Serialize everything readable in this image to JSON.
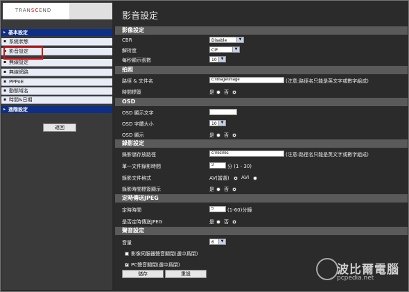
{
  "logo": {
    "prefix": "TRAN",
    "accent": "SC",
    "suffix": "END"
  },
  "sidebar": {
    "items": [
      {
        "label": "基本設定",
        "kind": "head"
      },
      {
        "label": "系統狀態",
        "kind": "sub"
      },
      {
        "label": "影音設定",
        "kind": "sub"
      },
      {
        "label": "無線設定",
        "kind": "sub"
      },
      {
        "label": "無線網路",
        "kind": "sub"
      },
      {
        "label": "PPPoE",
        "kind": "sub"
      },
      {
        "label": "動態域名",
        "kind": "sub"
      },
      {
        "label": "時間&日期",
        "kind": "sub"
      },
      {
        "label": "進階設定",
        "kind": "head"
      }
    ],
    "back_label": "返回"
  },
  "main": {
    "title": "影音設定",
    "video": {
      "section": "影像設定",
      "cbr_label": "CBR",
      "cbr_value": "Disable",
      "res_label": "解析度",
      "res_value": "CIF",
      "fps_label": "每秒顯示張數",
      "fps_value": "10"
    },
    "photo": {
      "section": "拍照",
      "path_label": "路徑 & 文件名",
      "path_value": "c:\\image\\image",
      "path_note": "(注意:路徑名只能是英文字或數字組成)",
      "ts_label": "時間標簽",
      "yes": "是",
      "no": "否"
    },
    "osd": {
      "section": "OSD",
      "text_label": "OSD 顯示文字",
      "text_value": "",
      "size_label": "OSD 字體大小",
      "size_value": "10",
      "show_label": "OSD 顯示",
      "yes": "是",
      "no": "否"
    },
    "record": {
      "section": "錄影設定",
      "path_label": "錄影儲存放路徑",
      "path_value": "c:\\rec\\rec",
      "path_note": "(注意:路徑名只能是英文字或數字組成)",
      "time_label": "單一文件錄影時間",
      "time_value": "3",
      "time_unit": "分 (1 - 30)",
      "format_label": "錄影文件格式",
      "format_av": "AV(當選)",
      "format_avi": "AVI",
      "ts_label": "錄影時間標簽顯示",
      "yes": "是",
      "no": "否"
    },
    "jpeg": {
      "section": "定時傳送JPEG",
      "interval_label": "定時時間",
      "interval_value": "5",
      "interval_unit": "(1-60)分鐘",
      "send_label": "是否定時傳送JPEG",
      "yes": "是",
      "no": "否"
    },
    "audio": {
      "section": "聲音設定",
      "vol_label": "音量",
      "vol_value": "6",
      "server_mute_label": "影像伺服器聲音關閉(選中爲閉)",
      "pc_mute_label": "PC聲音關閉(選中爲閉)"
    },
    "save_label": "儲存",
    "reset_label": "重設"
  },
  "watermark": {
    "cn": "波比爾電腦",
    "en": "pcpedia.net"
  },
  "colors": {
    "nav_head": "#0d2f88",
    "nav_sub": "#e8ecf4",
    "section": "#5a5a5a",
    "highlight": "#e01010"
  }
}
